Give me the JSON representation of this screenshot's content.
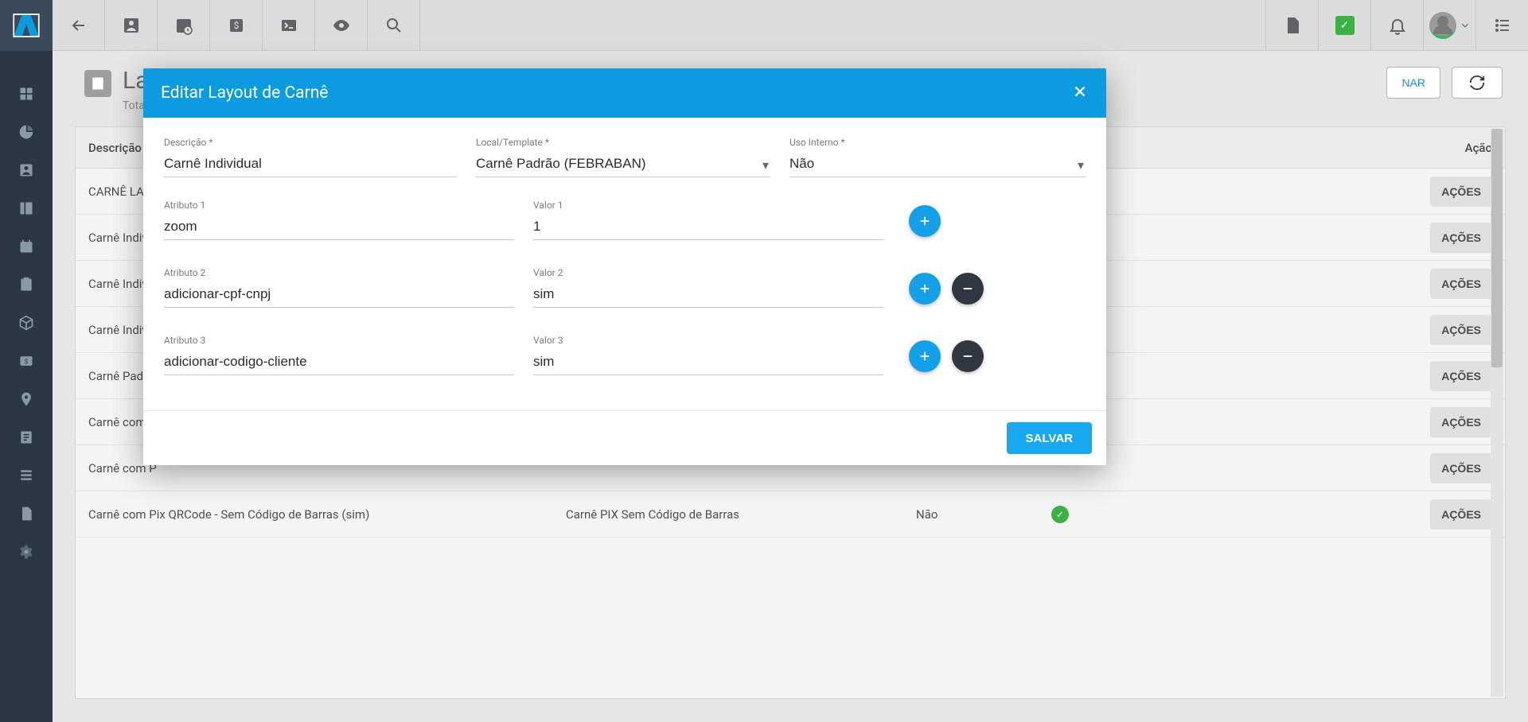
{
  "page": {
    "title_partial": "Layo",
    "subtitle_partial": "Total de",
    "buttons": {
      "adicionar_partial": "NAR",
      "refresh": "↻"
    }
  },
  "table": {
    "headers": {
      "descricao": "Descrição",
      "acao": "Ação"
    },
    "rows": [
      {
        "descricao": "CARNÊ LAVY",
        "template": "",
        "uso": "",
        "publicado": false,
        "acao": "AÇÕES"
      },
      {
        "descricao": "Carnê Individ",
        "template": "",
        "uso": "",
        "publicado": false,
        "acao": "AÇÕES"
      },
      {
        "descricao": "Carnê Individ",
        "template": "",
        "uso": "",
        "publicado": false,
        "acao": "AÇÕES"
      },
      {
        "descricao": "Carnê Individ",
        "template": "",
        "uso": "",
        "publicado": false,
        "acao": "AÇÕES"
      },
      {
        "descricao": "Carnê Padrão",
        "template": "",
        "uso": "",
        "publicado": false,
        "acao": "AÇÕES"
      },
      {
        "descricao": "Carnê com P",
        "template": "",
        "uso": "",
        "publicado": false,
        "acao": "AÇÕES"
      },
      {
        "descricao": "Carnê com P",
        "template": "",
        "uso": "",
        "publicado": false,
        "acao": "AÇÕES"
      },
      {
        "descricao": "Carnê com Pix QRCode - Sem Código de Barras (sim)",
        "template": "Carnê PIX Sem Código de Barras",
        "uso": "Não",
        "publicado": true,
        "acao": "AÇÕES"
      }
    ]
  },
  "modal": {
    "title": "Editar Layout de Carnê",
    "labels": {
      "descricao": "Descrição *",
      "template": "Local/Template *",
      "uso_interno": "Uso Interno *"
    },
    "values": {
      "descricao": "Carnê Individual",
      "template": "Carnê Padrão (FEBRABAN)",
      "uso_interno": "Não"
    },
    "attributes": [
      {
        "attr_label": "Atributo 1",
        "attr_value": "zoom",
        "val_label": "Valor 1",
        "val_value": "1",
        "has_remove": false
      },
      {
        "attr_label": "Atributo 2",
        "attr_value": "adicionar-cpf-cnpj",
        "val_label": "Valor 2",
        "val_value": "sim",
        "has_remove": true
      },
      {
        "attr_label": "Atributo 3",
        "attr_value": "adicionar-codigo-cliente",
        "val_label": "Valor 3",
        "val_value": "sim",
        "has_remove": true
      }
    ],
    "save": "SALVAR"
  }
}
